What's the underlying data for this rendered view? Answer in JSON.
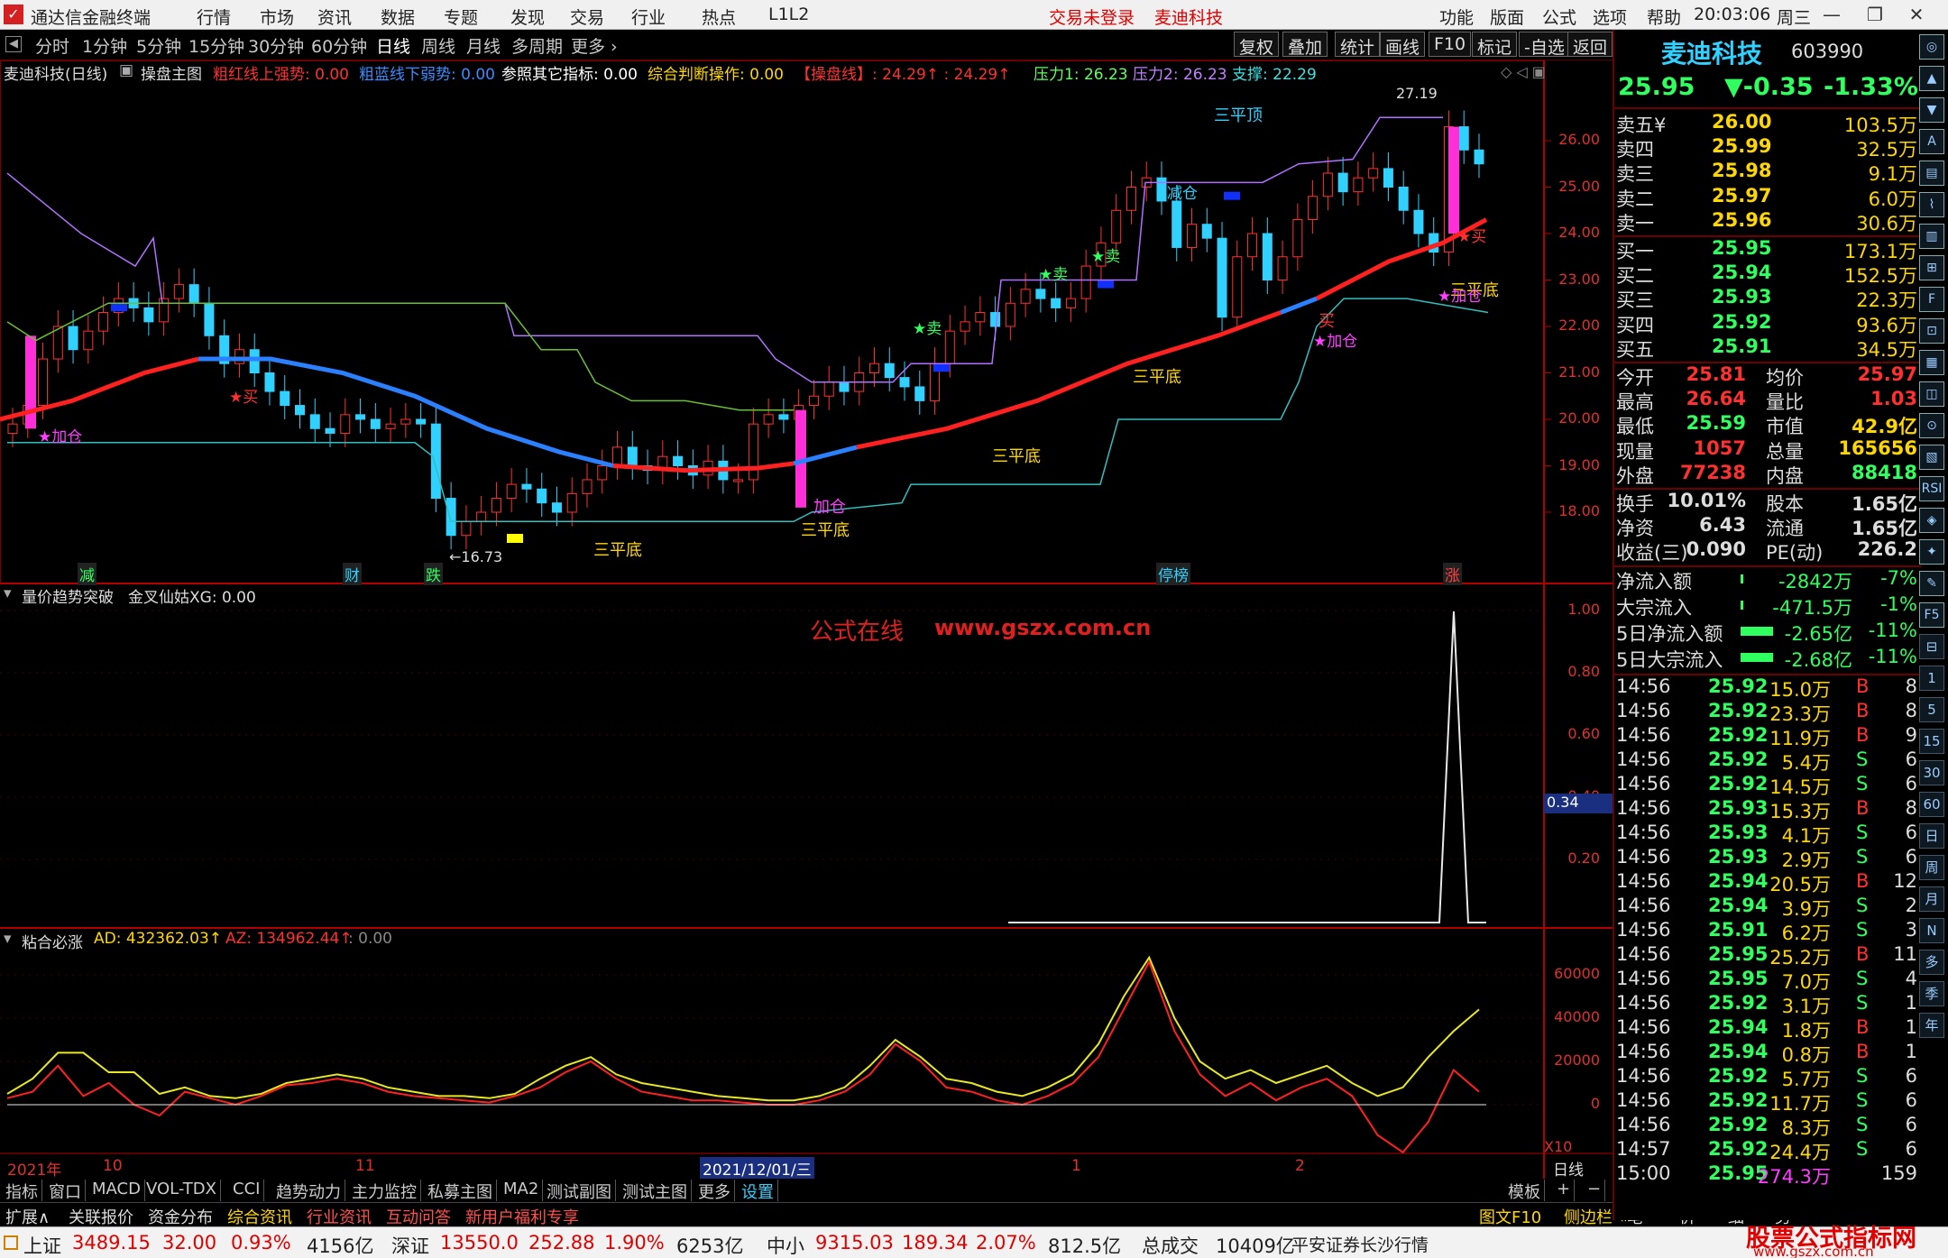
{
  "title_bar": {
    "app_name": "通达信金融终端",
    "menus": [
      "行情",
      "市场",
      "资讯",
      "数据",
      "专题",
      "发现",
      "交易",
      "行业",
      "热点",
      "L1L2"
    ],
    "trade_status": "交易未登录",
    "stock_name": "麦迪科技",
    "right_menus": [
      "功能",
      "版面",
      "公式",
      "选项",
      "帮助"
    ],
    "time": "20:03:06",
    "weekday": "周三"
  },
  "period_bar": {
    "periods": [
      "分时",
      "1分钟",
      "5分钟",
      "15分钟",
      "30分钟",
      "60分钟",
      "日线",
      "周线",
      "月线",
      "多周期",
      "更多 ›"
    ],
    "active": "日线",
    "tools": [
      "复权",
      "叠加",
      "统计",
      "画线",
      "F10",
      "标记",
      "-自选",
      "返回"
    ]
  },
  "main_indicator": {
    "title": "麦迪科技(日线)",
    "formula": "操盘主图",
    "items": [
      {
        "text": "粗红线上强势: 0.00",
        "color": "#ff3030"
      },
      {
        "text": "粗蓝线下弱势: 0.00",
        "color": "#3a8cff"
      },
      {
        "text": "参照其它指标: 0.00",
        "color": "#ffffff"
      },
      {
        "text": "综合判断操作: 0.00",
        "color": "#ffd700"
      },
      {
        "text": "【操盘线】: 24.29↑ : 24.29↑",
        "color": "#ff3030"
      },
      {
        "text": "压力1: 26.23",
        "color": "#60ff60"
      },
      {
        "text": "压力2: 26.23",
        "color": "#c080ff"
      },
      {
        "text": "支撑: 22.29",
        "color": "#40e0e0"
      }
    ]
  },
  "main_axis": [
    "26.00",
    "25.00",
    "24.00",
    "23.00",
    "22.00",
    "21.00",
    "20.00",
    "19.00",
    "18.00"
  ],
  "main_annotations": {
    "high": "27.19",
    "low": "←16.73",
    "top_label": "三平顶",
    "tri_bottom": "三平底",
    "add": "★加仓",
    "sell": "★卖",
    "buy": "★买",
    "reduce": "减仓",
    "jia": "加仓",
    "buy2": "买"
  },
  "event_tags": [
    "减",
    "财",
    "跌",
    "停榜",
    "涨"
  ],
  "sub1": {
    "title": "量价趋势突破",
    "formula": "金叉仙姑XG: 0.00",
    "axis": [
      "1.00",
      "0.80",
      "0.60",
      "0.40",
      "0.20"
    ],
    "current": "0.34",
    "watermark_cn": "公式在线",
    "watermark_url": "www.gszx.com.cn"
  },
  "sub2": {
    "title": "粘合必涨",
    "ad": "AD: 432362.03↑",
    "az": "AZ: 134962.44↑",
    "extra": ": 0.00",
    "axis": [
      "60000",
      "40000",
      "20000",
      "0"
    ],
    "x10": "X10"
  },
  "date_axis": {
    "labels": [
      "2021年",
      "10",
      "11",
      "2021/12/01/三",
      "1",
      "2"
    ],
    "period": "日线"
  },
  "bottom_tabs": [
    "指标",
    "窗口",
    "MACD",
    "VOL-TDX",
    "CCI",
    "趋势动力",
    "主力监控",
    "私募主图",
    "MA2",
    "测试副图",
    "测试主图",
    "更多",
    "设置"
  ],
  "bottom_right": [
    "模板",
    "+",
    "−"
  ],
  "bottom_menu": [
    "扩展∧",
    "关联报价",
    "资金分布",
    "综合资讯",
    "行业资讯",
    "互动问答",
    "新用户福利专享"
  ],
  "bottom_menu_right": [
    "图文F10",
    "侧边栏 «",
    "笔",
    "价",
    "细",
    "势"
  ],
  "quote": {
    "name": "麦迪科技",
    "code": "603990",
    "price": "25.95",
    "change": "▼-0.35",
    "pct": "-1.33%",
    "asks": [
      [
        "卖五¥",
        "26.00",
        "103.5万"
      ],
      [
        "卖四",
        "25.99",
        "32.5万"
      ],
      [
        "卖三",
        "25.98",
        "9.1万"
      ],
      [
        "卖二",
        "25.97",
        "6.0万"
      ],
      [
        "卖一",
        "25.96",
        "30.6万"
      ]
    ],
    "bids": [
      [
        "买一",
        "25.95",
        "173.1万"
      ],
      [
        "买二",
        "25.94",
        "152.5万"
      ],
      [
        "买三",
        "25.93",
        "22.3万"
      ],
      [
        "买四",
        "25.92",
        "93.6万"
      ],
      [
        "买五",
        "25.91",
        "34.5万"
      ]
    ],
    "stats": [
      [
        "今开",
        "25.81",
        "均价",
        "25.97"
      ],
      [
        "最高",
        "26.64",
        "量比",
        "1.03"
      ],
      [
        "最低",
        "25.59",
        "市值",
        "42.9亿"
      ],
      [
        "现量",
        "1057",
        "总量",
        "165656"
      ],
      [
        "外盘",
        "77238",
        "内盘",
        "88418"
      ]
    ],
    "stats2": [
      [
        "换手",
        "10.01%",
        "股本",
        "1.65亿"
      ],
      [
        "净资",
        "6.43",
        "流通",
        "1.65亿"
      ],
      [
        "收益(三)",
        "0.090",
        "PE(动)",
        "226.2"
      ]
    ],
    "flows": [
      [
        "净流入额",
        "-2842万",
        "-7%"
      ],
      [
        "大宗流入",
        "-471.5万",
        "-1%"
      ],
      [
        "5日净流入额",
        "-2.65亿",
        "-11%"
      ],
      [
        "5日大宗流入",
        "-2.68亿",
        "-11%"
      ]
    ],
    "ticks": [
      [
        "14:56",
        "25.92",
        "15.0万",
        "B",
        "8"
      ],
      [
        "14:56",
        "25.92",
        "23.3万",
        "B",
        "8"
      ],
      [
        "14:56",
        "25.92",
        "11.9万",
        "B",
        "9"
      ],
      [
        "14:56",
        "25.92",
        "5.4万",
        "S",
        "6"
      ],
      [
        "14:56",
        "25.92",
        "14.5万",
        "S",
        "6"
      ],
      [
        "14:56",
        "25.93",
        "15.3万",
        "B",
        "8"
      ],
      [
        "14:56",
        "25.93",
        "4.1万",
        "S",
        "6"
      ],
      [
        "14:56",
        "25.93",
        "2.9万",
        "S",
        "6"
      ],
      [
        "14:56",
        "25.94",
        "20.5万",
        "B",
        "12"
      ],
      [
        "14:56",
        "25.94",
        "3.9万",
        "S",
        "2"
      ],
      [
        "14:56",
        "25.91",
        "6.2万",
        "S",
        "3"
      ],
      [
        "14:56",
        "25.95",
        "25.2万",
        "B",
        "11"
      ],
      [
        "14:56",
        "25.95",
        "7.0万",
        "S",
        "4"
      ],
      [
        "14:56",
        "25.92",
        "3.1万",
        "S",
        "1"
      ],
      [
        "14:56",
        "25.94",
        "1.8万",
        "B",
        "1"
      ],
      [
        "14:56",
        "25.94",
        "0.8万",
        "B",
        "1"
      ],
      [
        "14:56",
        "25.92",
        "5.7万",
        "S",
        "6"
      ],
      [
        "14:56",
        "25.92",
        "11.7万",
        "S",
        "6"
      ],
      [
        "14:56",
        "25.92",
        "8.3万",
        "S",
        "6"
      ],
      [
        "14:57",
        "25.92",
        "24.4万",
        "S",
        "6"
      ],
      [
        "15:00",
        "25.95",
        "274.3万",
        "",
        "159"
      ]
    ]
  },
  "side_icons": [
    "◎",
    "▲",
    "▼",
    "A",
    "▤",
    "⌇",
    "▥",
    "⊞",
    "F",
    "⊡",
    "▦",
    "◫",
    "⊙",
    "▧",
    "RSI",
    "◈",
    "✦",
    "✎",
    "F5",
    "⊟",
    "1",
    "5",
    "15",
    "30",
    "60",
    "日",
    "周",
    "月",
    "N",
    "多",
    "季",
    "年"
  ],
  "status": {
    "sh_label": "上证",
    "sh": "3489.15",
    "sh_chg": "32.00",
    "sh_pct": "0.93%",
    "sh_amt": "4156亿",
    "sz_label": "深证",
    "sz": "13550.0",
    "sz_chg": "252.88",
    "sz_pct": "1.90%",
    "sz_amt": "6253亿",
    "zx_label": "中小",
    "zx": "9315.03",
    "zx_chg": "189.34",
    "zx_pct": "2.07%",
    "zx_amt": "812.5亿",
    "total_label": "总成交",
    "total": "10409亿",
    "broker": "平安证券长沙行情",
    "site_cn": "股票公式指标网",
    "site_url": "www.gszx.com.cn"
  }
}
